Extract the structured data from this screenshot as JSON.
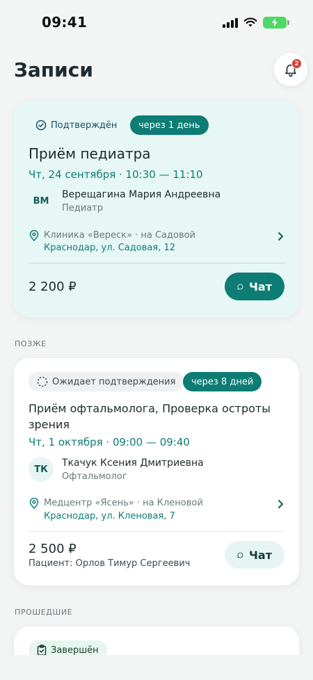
{
  "status_bar": {
    "time": "09:41"
  },
  "header": {
    "title": "Записи",
    "notifications_count": "2"
  },
  "upcoming": {
    "status_label": "Подтверждён",
    "countdown": "через 1 день",
    "title": "Приём педиатра",
    "datetime": "Чт, 24 сентября · 10:30 — 11:10",
    "doctor_initials": "ВМ",
    "doctor_name": "Верещагина Мария Андреевна",
    "doctor_role": "Педиатр",
    "clinic": "Клиника «Вереск» · на Садовой",
    "address": "Краснодар, ул. Садовая, 12",
    "price": "2 200 ₽",
    "chat_label": "Чат"
  },
  "later": {
    "section_label": "ПОЗЖЕ",
    "status_label": "Ожидает подтверждения",
    "countdown": "через 8 дней",
    "title": "Приём офтальмолога, Проверка остроты зрения",
    "datetime": "Чт, 1 октября · 09:00 — 09:40",
    "doctor_initials": "ТК",
    "doctor_name": "Ткачук Ксения Дмитриевна",
    "doctor_role": "Офтальмолог",
    "clinic": "Медцентр «Ясень» · на Кленовой",
    "address": "Краснодар, ул. Кленовая, 7",
    "price": "2 500 ₽",
    "patient": "Пациент: Орлов Тимур Сергеевич",
    "chat_label": "Чат"
  },
  "past": {
    "section_label": "ПРОШЕДШИЕ",
    "status_label": "Завершён"
  },
  "colors": {
    "accent": "#0d7c74",
    "highlight_card": "#e6f7f5",
    "badge": "#d93a3a"
  }
}
